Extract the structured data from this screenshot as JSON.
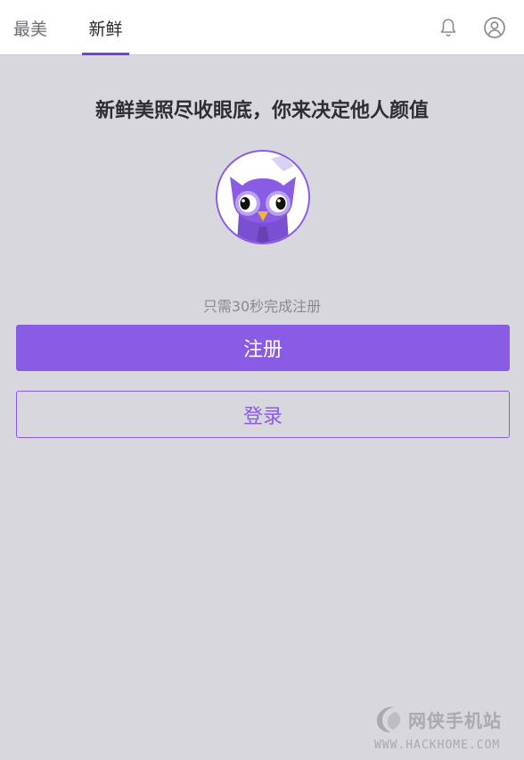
{
  "tabs": [
    {
      "label": "最美",
      "active": false
    },
    {
      "label": "新鲜",
      "active": true
    }
  ],
  "header_icons": {
    "notifications": "bell-icon",
    "profile": "user-circle-icon"
  },
  "main": {
    "headline": "新鲜美照尽收眼底，你来决定他人颜值",
    "avatar": "owl-mascot",
    "hint": "只需30秒完成注册",
    "register_label": "注册",
    "login_label": "登录"
  },
  "watermark": {
    "name": "网侠手机站",
    "url": "WWW.HACKHOME.COM"
  },
  "colors": {
    "accent": "#8a5ce6",
    "tab_indicator": "#7a3fd6",
    "background": "#d7d7dd"
  }
}
